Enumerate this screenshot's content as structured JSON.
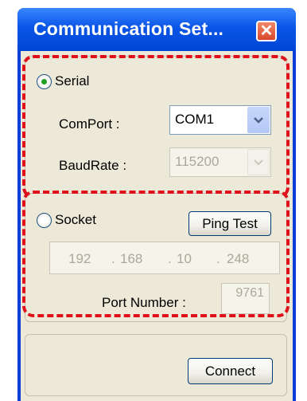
{
  "window": {
    "title": "Communication Set...",
    "close_label": "✕"
  },
  "serial": {
    "radio_label": "Serial",
    "selected": true,
    "comport_label": "ComPort :",
    "comport_value": "COM1",
    "baudrate_label": "BaudRate :",
    "baudrate_value": "115200"
  },
  "socket": {
    "radio_label": "Socket",
    "selected": false,
    "ping_button": "Ping Test",
    "ip": {
      "o1": "192",
      "d1": ".",
      "o2": "168",
      "d2": ".",
      "o3": "10",
      "d3": ".",
      "o4": "248"
    },
    "port_label": "Port Number :",
    "port_value": "9761"
  },
  "actions": {
    "connect_button": "Connect"
  },
  "colors": {
    "highlight": "#e0101a",
    "titlebar": "#0a55e6",
    "face": "#ece9d8"
  },
  "icons": {
    "dropdown": "chevron-down-icon",
    "close": "close-icon"
  }
}
